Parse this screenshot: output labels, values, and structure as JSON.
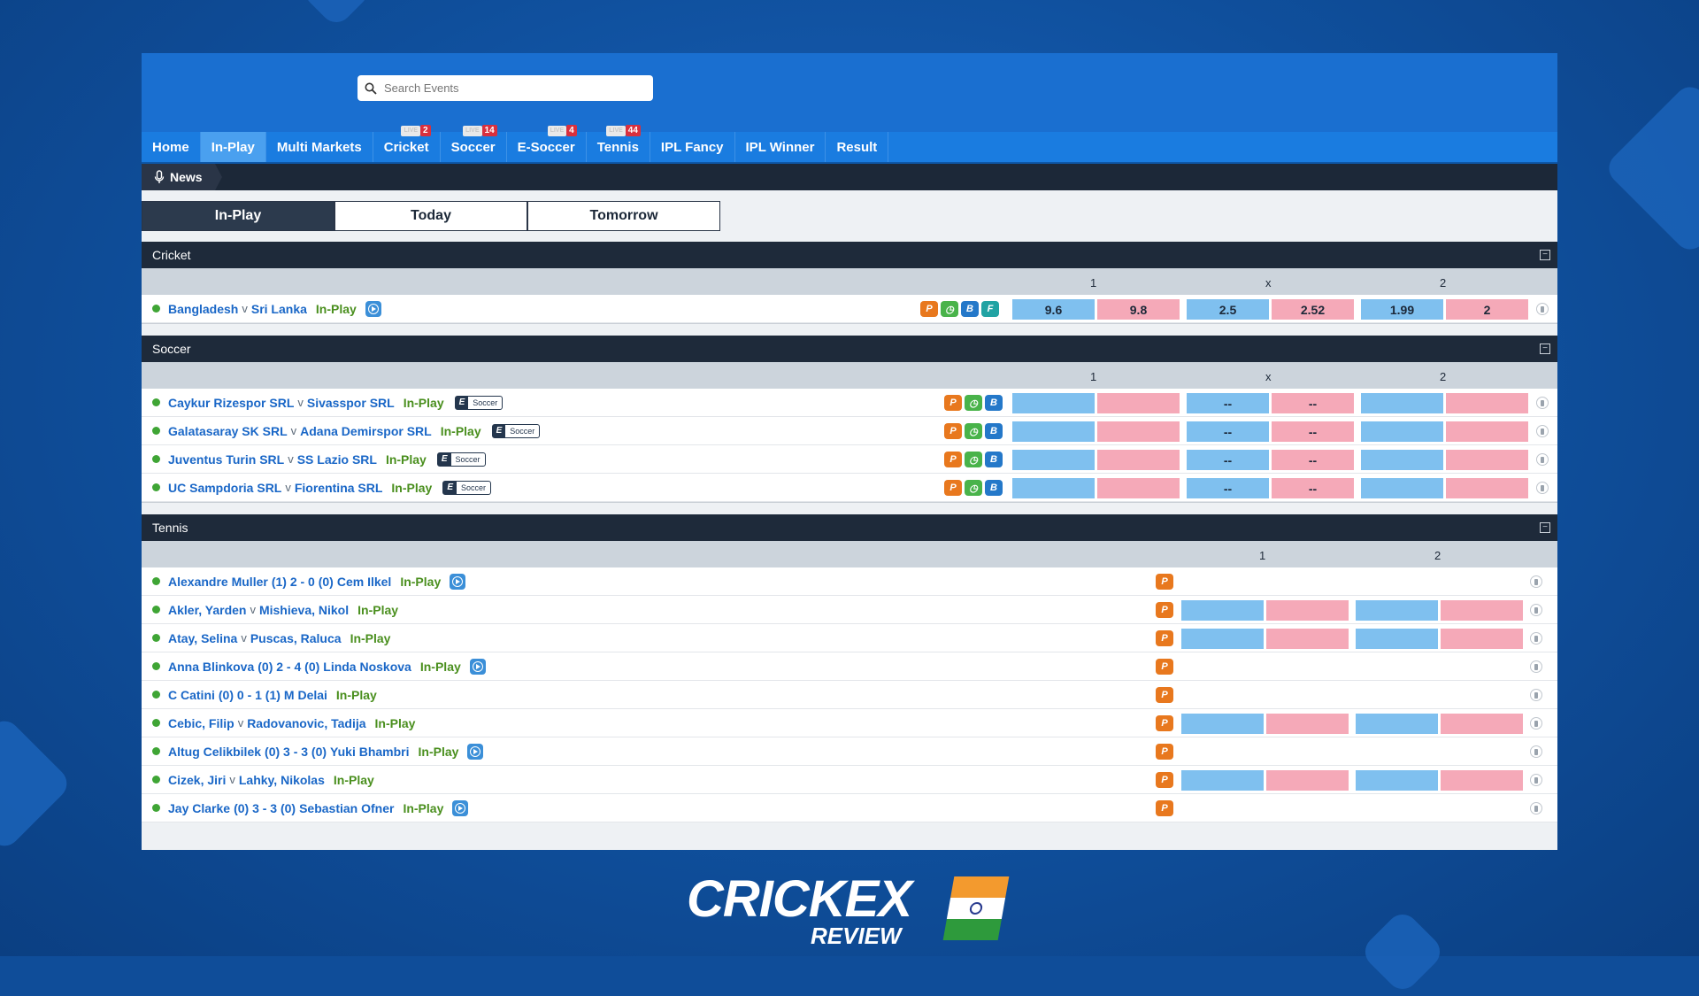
{
  "search": {
    "placeholder": "Search Events"
  },
  "nav": [
    {
      "label": "Home"
    },
    {
      "label": "In-Play",
      "active": true
    },
    {
      "label": "Multi Markets"
    },
    {
      "label": "Cricket",
      "count": "2",
      "live": "LIVE"
    },
    {
      "label": "Soccer",
      "count": "14",
      "live": "LIVE"
    },
    {
      "label": "E-Soccer",
      "count": "4",
      "live": "LIVE"
    },
    {
      "label": "Tennis",
      "count": "44",
      "live": "LIVE"
    },
    {
      "label": "IPL Fancy"
    },
    {
      "label": "IPL Winner"
    },
    {
      "label": "Result"
    }
  ],
  "news": {
    "label": "News"
  },
  "tabs": [
    {
      "label": "In-Play"
    },
    {
      "label": "Today"
    },
    {
      "label": "Tomorrow"
    }
  ],
  "cricket": {
    "title": "Cricket",
    "cols": [
      "1",
      "x",
      "2"
    ],
    "rows": [
      {
        "team1": "Bangladesh",
        "vs": "v",
        "team2": "Sri Lanka",
        "status": "In-Play",
        "odds": [
          "9.6",
          "9.8",
          "2.5",
          "2.52",
          "1.99",
          "2"
        ]
      }
    ]
  },
  "soccer": {
    "title": "Soccer",
    "cols": [
      "1",
      "x",
      "2"
    ],
    "esoccer_e": "E",
    "esoccer_label": "Soccer",
    "draw_placeholder": "--",
    "rows": [
      {
        "team1": "Caykur Rizespor SRL",
        "vs": "v",
        "team2": "Sivasspor SRL",
        "status": "In-Play"
      },
      {
        "team1": "Galatasaray SK SRL",
        "vs": "v",
        "team2": "Adana Demirspor SRL",
        "status": "In-Play"
      },
      {
        "team1": "Juventus Turin SRL",
        "vs": "v",
        "team2": "SS Lazio SRL",
        "status": "In-Play"
      },
      {
        "team1": "UC Sampdoria SRL",
        "vs": "v",
        "team2": "Fiorentina SRL",
        "status": "In-Play"
      }
    ]
  },
  "tennis": {
    "title": "Tennis",
    "cols": [
      "1",
      "2"
    ],
    "rows": [
      {
        "team1": "Alexandre Muller",
        "score": "(1) 2 - 0 (0)",
        "team2": "Cem Ilkel",
        "status": "In-Play"
      },
      {
        "team1": "Akler, Yarden",
        "vs": "v",
        "team2": "Mishieva, Nikol",
        "status": "In-Play"
      },
      {
        "team1": "Atay, Selina",
        "vs": "v",
        "team2": "Puscas, Raluca",
        "status": "In-Play"
      },
      {
        "team1": "Anna Blinkova",
        "score": "(0) 2 - 4 (0)",
        "team2": "Linda Noskova",
        "status": "In-Play"
      },
      {
        "team1": "C Catini",
        "score": "(0) 0 - 1 (1)",
        "team2": "M Delai",
        "status": "In-Play"
      },
      {
        "team1": "Cebic, Filip",
        "vs": "v",
        "team2": "Radovanovic, Tadija",
        "status": "In-Play"
      },
      {
        "team1": "Altug Celikbilek",
        "score": "(0) 3 - 3 (0)",
        "team2": "Yuki Bhambri",
        "status": "In-Play"
      },
      {
        "team1": "Cizek, Jiri",
        "vs": "v",
        "team2": "Lahky, Nikolas",
        "status": "In-Play"
      },
      {
        "team1": "Jay Clarke",
        "score": "(0) 3 - 3 (0)",
        "team2": "Sebastian Ofner",
        "status": "In-Play"
      }
    ]
  },
  "tag_letters": {
    "p": "P",
    "b": "B",
    "f": "F"
  },
  "brand": {
    "logo": "CRICKEX",
    "sub": "REVIEW"
  },
  "colors": {
    "back": "#7fc0ef",
    "lay": "#f5a9b8",
    "nav": "#1a7ce0",
    "header": "#1e2a3a",
    "inplay": "#4a8f1e"
  }
}
